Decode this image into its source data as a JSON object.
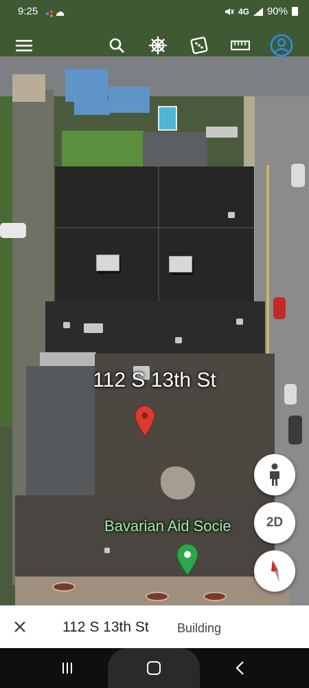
{
  "status_bar": {
    "time": "9:25",
    "network": "4G",
    "battery": "90%"
  },
  "toolbar": {
    "menu_icon": "hamburger-menu-icon",
    "search_icon": "search-icon",
    "voyager_icon": "ship-wheel-icon",
    "random_icon": "dice-icon",
    "measure_icon": "ruler-icon",
    "account_icon": "account-icon"
  },
  "map": {
    "address_label": "112 S 13th St",
    "poi_label": "Bavarian Aid Socie",
    "poi_pin_color": "#2aa84b",
    "address_pin_color": "#d93b2f"
  },
  "controls": {
    "pegman_icon": "person-icon",
    "view_toggle": "2D",
    "compass_icon": "compass-icon"
  },
  "place_card": {
    "title": "112 S 13th St",
    "type": "Building",
    "close_icon": "close-icon"
  },
  "nav_bar": {
    "recents_icon": "recents-icon",
    "home_icon": "home-icon",
    "back_icon": "back-icon"
  }
}
